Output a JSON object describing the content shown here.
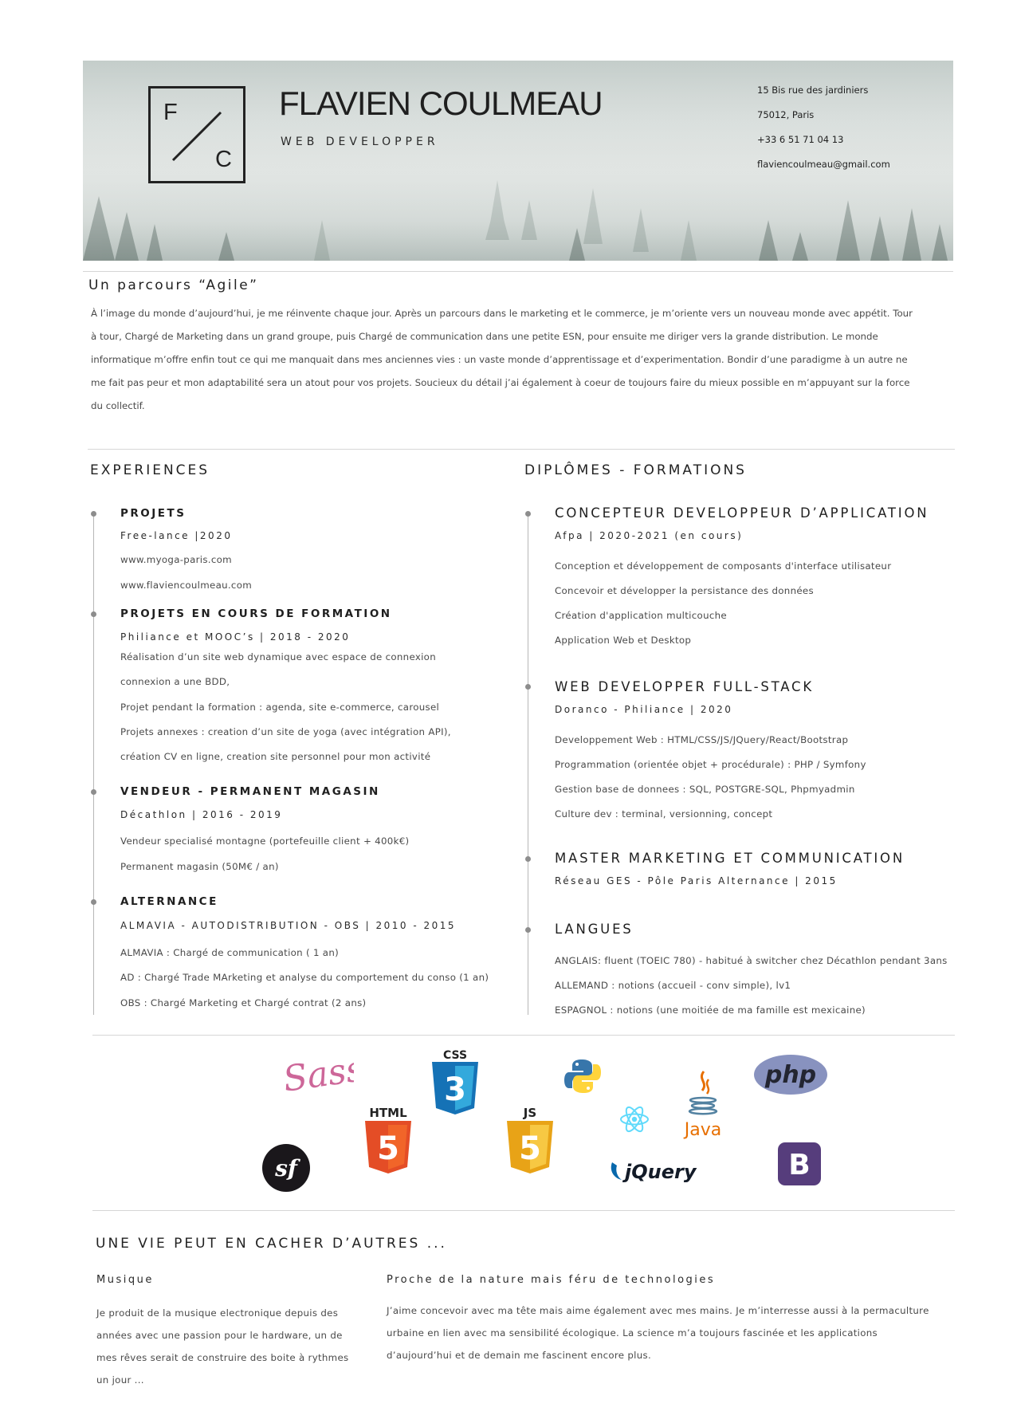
{
  "header": {
    "logo_f": "F",
    "logo_c": "C",
    "name": "FLAVIEN COULMEAU",
    "role": "WEB DEVELOPPER",
    "contact": [
      "15 Bis rue des jardiniers",
      "75012, Paris",
      "+33 6 51 71 04 13",
      "flaviencoulmeau@gmail.com"
    ]
  },
  "intro": {
    "title": "Un parcours “Agile”",
    "lines": [
      "À l’image du monde d’aujourd’hui, je me réinvente chaque jour. Après un parcours dans le marketing et le commerce, je m’oriente vers un nouveau monde avec appétit. Tour",
      "à tour, Chargé de Marketing dans un grand groupe, puis Chargé de communication dans une petite ESN, pour ensuite me diriger vers la grande distribution. Le monde",
      "informatique m’offre enfin tout ce qui me manquait dans mes anciennes vies : un vaste monde d’apprentissage et d’experimentation.  Bondir d’une paradigme à un autre ne",
      "me fait pas peur et mon adaptabilité sera un atout pour vos projets. Soucieux du détail j’ai également à coeur de toujours faire du mieux possible en m’appuyant sur la force",
      "du collectif."
    ]
  },
  "experiences": {
    "title": "EXPERIENCES",
    "items": [
      {
        "title": "PROJETS",
        "sub": "Free-lance |2020",
        "lines": [
          "www.myoga-paris.com",
          "www.flaviencoulmeau.com"
        ]
      },
      {
        "title": "PROJETS EN COURS DE FORMATION",
        "sub": "Philiance et MOOC’s | 2018 - 2020",
        "lines": [
          "Réalisation d’un site web dynamique avec espace de connexion",
          "connexion a une BDD,",
          "Projet pendant la formation : agenda, site e-commerce, carousel",
          "Projets annexes : creation d’un site de yoga (avec intégration API),",
          "création CV en ligne, creation site personnel pour mon activité"
        ]
      },
      {
        "title": "VENDEUR - PERMANENT MAGASIN",
        "sub": "Décathlon | 2016 - 2019",
        "lines": [
          "Vendeur specialisé montagne (portefeuille client + 400k€)",
          "Permanent magasin (50M€ / an)"
        ]
      },
      {
        "title": "ALTERNANCE",
        "sub": "ALMAVIA - AUTODISTRIBUTION - OBS | 2010 - 2015",
        "lines": [
          "ALMAVIA : Chargé de communication ( 1 an)",
          "AD : Chargé Trade MArketing et analyse du comportement du conso (1 an)",
          "OBS : Chargé Marketing et Chargé contrat (2 ans)"
        ]
      }
    ]
  },
  "education": {
    "title": "DIPLÔMES - FORMATIONS",
    "items": [
      {
        "title": "CONCEPTEUR DEVELOPPEUR D’APPLICATION",
        "sub": "Afpa | 2020-2021 (en cours)",
        "lines": [
          "Conception et développement de composants d'interface utilisateur",
          "Concevoir et développer la persistance des données",
          "Création d'application multicouche",
          "Application Web et Desktop"
        ]
      },
      {
        "title": "WEB DEVELOPPER FULL-STACK",
        "sub": "Doranco - Philiance | 2020",
        "lines": [
          "Developpement Web : HTML/CSS/JS/JQuery/React/Bootstrap",
          "Programmation (orientée objet + procédurale) : PHP / Symfony",
          "Gestion base de donnees : SQL, POSTGRE-SQL, Phpmyadmin",
          "Culture dev : terminal, versionning, concept"
        ]
      },
      {
        "title": "MASTER MARKETING ET COMMUNICATION",
        "sub": "Réseau GES - Pôle Paris Alternance | 2015",
        "lines": []
      },
      {
        "title": "LANGUES",
        "sub": "",
        "lines": [
          "ANGLAIS: fluent (TOEIC 780) - habitué à switcher chez Décathlon pendant 3ans",
          "ALLEMAND : notions (accueil - conv simple), lv1",
          "ESPAGNOL : notions (une moitiée de ma famille est mexicaine)"
        ]
      }
    ]
  },
  "tech": {
    "icons": [
      "sass-icon",
      "css3-icon",
      "python-icon",
      "react-icon",
      "java-icon",
      "php-icon",
      "symfony-icon",
      "html5-icon",
      "js-icon",
      "jquery-icon",
      "bootstrap-icon"
    ],
    "sass": "Sass",
    "css": "CSS",
    "html": "HTML",
    "js": "JS",
    "php": "php",
    "java": "Java",
    "jquery": "jQuery",
    "bootstrap": "B",
    "symfony": "sf",
    "css_num": "3",
    "html_num": "5",
    "js_num": "5"
  },
  "hobbies": {
    "title": "UNE VIE PEUT EN CACHER D’AUTRES ...",
    "music": {
      "title": "Musique",
      "lines": [
        "Je  produit de la musique electronique depuis des",
        "années avec une passion pour le hardware, un de",
        "mes rêves serait de construire des boite à rythmes",
        "un jour  ..."
      ]
    },
    "nature": {
      "title": "Proche de la nature mais féru de technologies",
      "lines": [
        "J’aime concevoir avec ma tête mais aime également avec mes mains. Je m’interresse aussi à la permaculture",
        "urbaine en lien avec ma sensibilité écologique. La science m’a toujours fascinée et les applications",
        "d’aujourd’hui et de demain me fascinent encore plus."
      ]
    }
  }
}
